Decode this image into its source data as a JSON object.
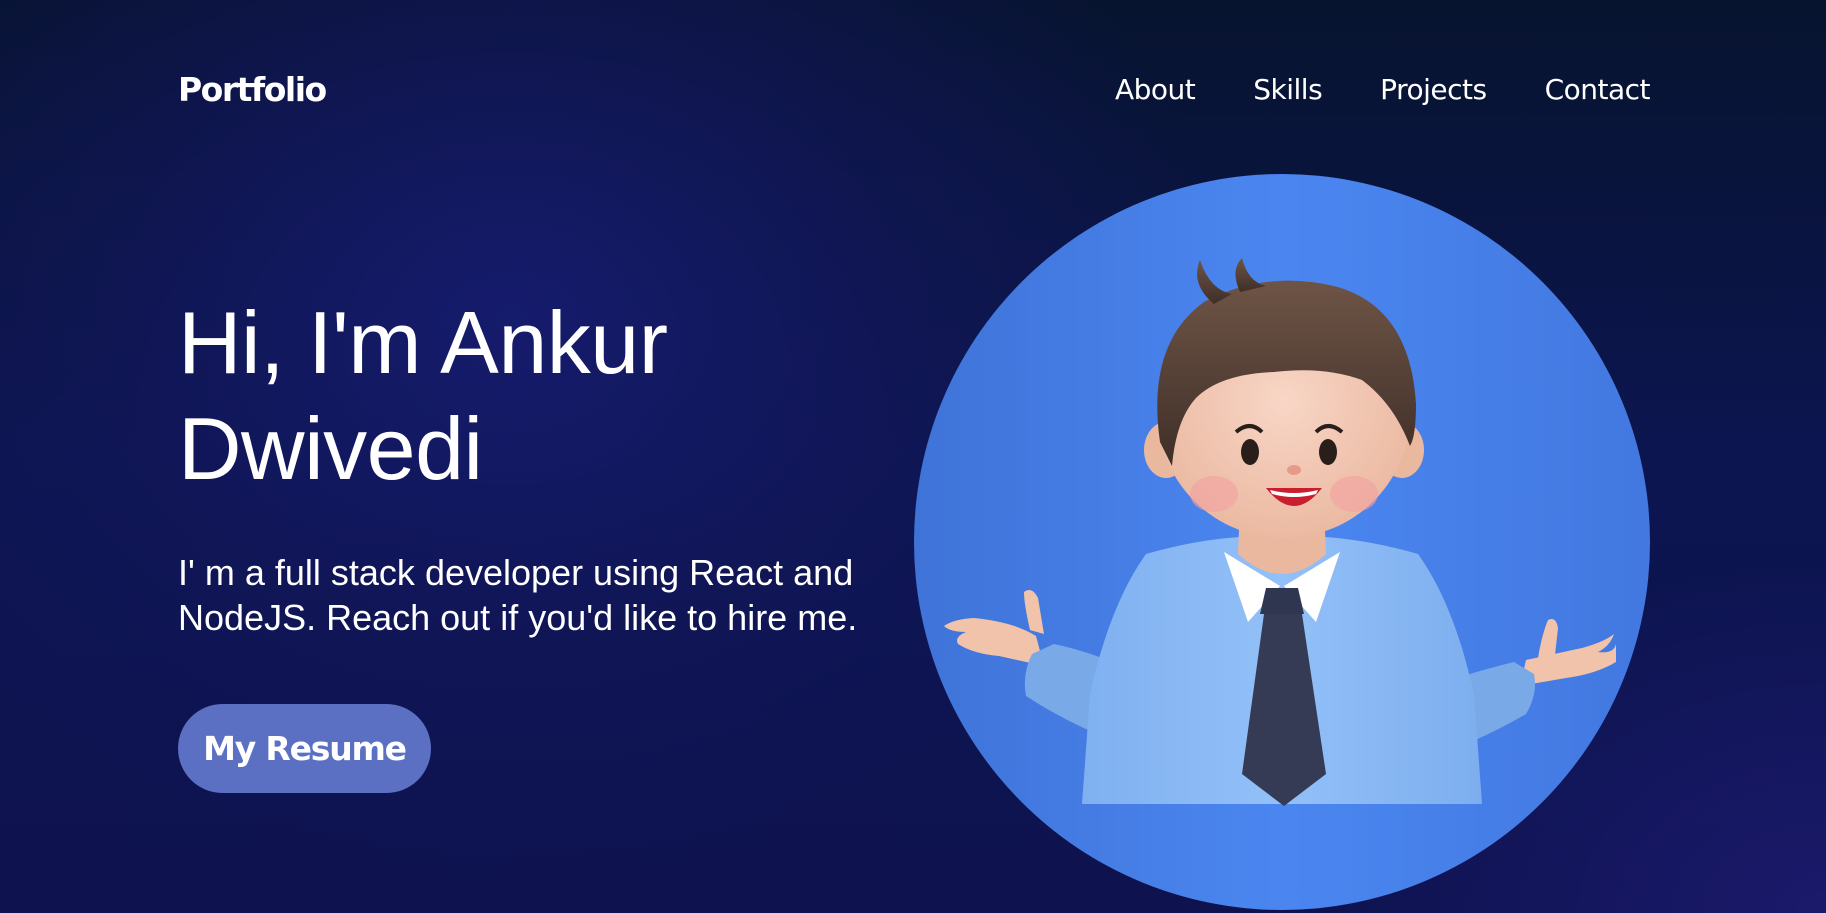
{
  "nav": {
    "brand": "Portfolio",
    "links": [
      {
        "label": "About"
      },
      {
        "label": "Skills"
      },
      {
        "label": "Projects"
      },
      {
        "label": "Contact"
      }
    ]
  },
  "hero": {
    "title_line1": "Hi, I'm Ankur",
    "title_line2": "Dwivedi",
    "subtitle_line1": "I' m a full stack developer using React and",
    "subtitle_line2": "NodeJS. Reach out if you'd like to hire me.",
    "cta_label": "My Resume"
  },
  "colors": {
    "background": "#0c1550",
    "button": "#5b6fc3",
    "avatar_circle": "#4a84ee"
  },
  "avatar": {
    "icon": "cartoon-developer-avatar"
  }
}
